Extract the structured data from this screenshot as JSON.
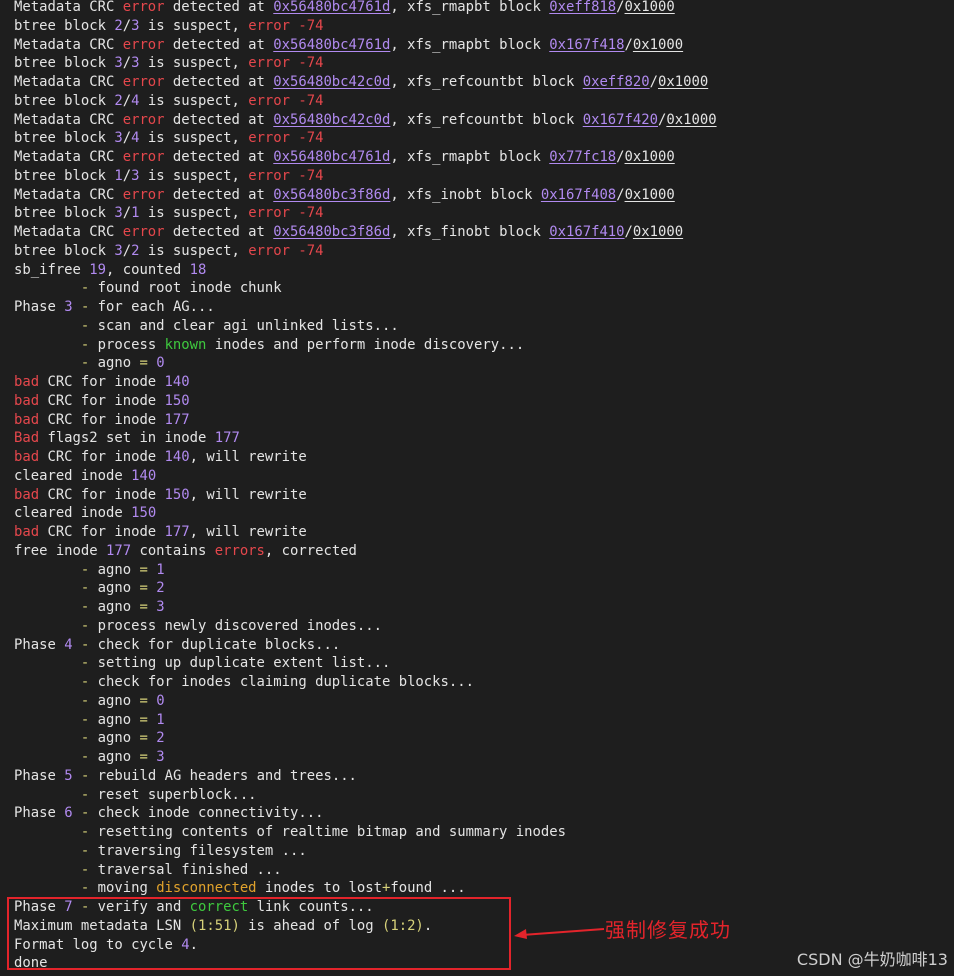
{
  "terminal_lines": [
    [
      [
        "Metadata CRC ",
        "plain"
      ],
      [
        "error",
        "red"
      ],
      [
        " detected at ",
        "plain"
      ],
      [
        "0x56480bc4761d",
        "link"
      ],
      [
        ", xfs_rmapbt block ",
        "plain"
      ],
      [
        "0xeff818",
        "link"
      ],
      [
        "/",
        "plain"
      ],
      [
        "0x1000",
        "ulw"
      ]
    ],
    [
      [
        "btree block ",
        "plain"
      ],
      [
        "2",
        "num"
      ],
      [
        "/",
        "plain"
      ],
      [
        "3",
        "num"
      ],
      [
        " is suspect, ",
        "plain"
      ],
      [
        "error",
        "red"
      ],
      [
        " ",
        "plain"
      ],
      [
        "-74",
        "red"
      ]
    ],
    [
      [
        "Metadata CRC ",
        "plain"
      ],
      [
        "error",
        "red"
      ],
      [
        " detected at ",
        "plain"
      ],
      [
        "0x56480bc4761d",
        "link"
      ],
      [
        ", xfs_rmapbt block ",
        "plain"
      ],
      [
        "0x167f418",
        "link"
      ],
      [
        "/",
        "plain"
      ],
      [
        "0x1000",
        "ulw"
      ]
    ],
    [
      [
        "btree block ",
        "plain"
      ],
      [
        "3",
        "num"
      ],
      [
        "/",
        "plain"
      ],
      [
        "3",
        "num"
      ],
      [
        " is suspect, ",
        "plain"
      ],
      [
        "error",
        "red"
      ],
      [
        " ",
        "plain"
      ],
      [
        "-74",
        "red"
      ]
    ],
    [
      [
        "Metadata CRC ",
        "plain"
      ],
      [
        "error",
        "red"
      ],
      [
        " detected at ",
        "plain"
      ],
      [
        "0x56480bc42c0d",
        "link"
      ],
      [
        ", xfs_refcountbt block ",
        "plain"
      ],
      [
        "0xeff820",
        "link"
      ],
      [
        "/",
        "plain"
      ],
      [
        "0x1000",
        "ulw"
      ]
    ],
    [
      [
        "btree block ",
        "plain"
      ],
      [
        "2",
        "num"
      ],
      [
        "/",
        "plain"
      ],
      [
        "4",
        "num"
      ],
      [
        " is suspect, ",
        "plain"
      ],
      [
        "error",
        "red"
      ],
      [
        " ",
        "plain"
      ],
      [
        "-74",
        "red"
      ]
    ],
    [
      [
        "Metadata CRC ",
        "plain"
      ],
      [
        "error",
        "red"
      ],
      [
        " detected at ",
        "plain"
      ],
      [
        "0x56480bc42c0d",
        "link"
      ],
      [
        ", xfs_refcountbt block ",
        "plain"
      ],
      [
        "0x167f420",
        "link"
      ],
      [
        "/",
        "plain"
      ],
      [
        "0x1000",
        "ulw"
      ]
    ],
    [
      [
        "btree block ",
        "plain"
      ],
      [
        "3",
        "num"
      ],
      [
        "/",
        "plain"
      ],
      [
        "4",
        "num"
      ],
      [
        " is suspect, ",
        "plain"
      ],
      [
        "error",
        "red"
      ],
      [
        " ",
        "plain"
      ],
      [
        "-74",
        "red"
      ]
    ],
    [
      [
        "Metadata CRC ",
        "plain"
      ],
      [
        "error",
        "red"
      ],
      [
        " detected at ",
        "plain"
      ],
      [
        "0x56480bc4761d",
        "link"
      ],
      [
        ", xfs_rmapbt block ",
        "plain"
      ],
      [
        "0x77fc18",
        "link"
      ],
      [
        "/",
        "plain"
      ],
      [
        "0x1000",
        "ulw"
      ]
    ],
    [
      [
        "btree block ",
        "plain"
      ],
      [
        "1",
        "num"
      ],
      [
        "/",
        "plain"
      ],
      [
        "3",
        "num"
      ],
      [
        " is suspect, ",
        "plain"
      ],
      [
        "error",
        "red"
      ],
      [
        " ",
        "plain"
      ],
      [
        "-74",
        "red"
      ]
    ],
    [
      [
        "Metadata CRC ",
        "plain"
      ],
      [
        "error",
        "red"
      ],
      [
        " detected at ",
        "plain"
      ],
      [
        "0x56480bc3f86d",
        "link"
      ],
      [
        ", xfs_inobt block ",
        "plain"
      ],
      [
        "0x167f408",
        "link"
      ],
      [
        "/",
        "plain"
      ],
      [
        "0x1000",
        "ulw"
      ]
    ],
    [
      [
        "btree block ",
        "plain"
      ],
      [
        "3",
        "num"
      ],
      [
        "/",
        "plain"
      ],
      [
        "1",
        "num"
      ],
      [
        " is suspect, ",
        "plain"
      ],
      [
        "error",
        "red"
      ],
      [
        " ",
        "plain"
      ],
      [
        "-74",
        "red"
      ]
    ],
    [
      [
        "Metadata CRC ",
        "plain"
      ],
      [
        "error",
        "red"
      ],
      [
        " detected at ",
        "plain"
      ],
      [
        "0x56480bc3f86d",
        "link"
      ],
      [
        ", xfs_finobt block ",
        "plain"
      ],
      [
        "0x167f410",
        "link"
      ],
      [
        "/",
        "plain"
      ],
      [
        "0x1000",
        "ulw"
      ]
    ],
    [
      [
        "btree block ",
        "plain"
      ],
      [
        "3",
        "num"
      ],
      [
        "/",
        "plain"
      ],
      [
        "2",
        "num"
      ],
      [
        " is suspect, ",
        "plain"
      ],
      [
        "error",
        "red"
      ],
      [
        " ",
        "plain"
      ],
      [
        "-74",
        "red"
      ]
    ],
    [
      [
        "sb_ifree ",
        "plain"
      ],
      [
        "19",
        "num"
      ],
      [
        ", counted ",
        "plain"
      ],
      [
        "18",
        "num"
      ]
    ],
    [
      [
        "        ",
        "plain"
      ],
      [
        "-",
        "gold"
      ],
      [
        " found root inode chunk",
        "plain"
      ]
    ],
    [
      [
        "Phase ",
        "plain"
      ],
      [
        "3",
        "num"
      ],
      [
        " ",
        "plain"
      ],
      [
        "-",
        "gold"
      ],
      [
        " for each AG...",
        "plain"
      ]
    ],
    [
      [
        "        ",
        "plain"
      ],
      [
        "-",
        "gold"
      ],
      [
        " scan and clear agi unlinked lists...",
        "plain"
      ]
    ],
    [
      [
        "        ",
        "plain"
      ],
      [
        "-",
        "gold"
      ],
      [
        " process ",
        "plain"
      ],
      [
        "known",
        "green"
      ],
      [
        " inodes and perform inode discovery...",
        "plain"
      ]
    ],
    [
      [
        "        ",
        "plain"
      ],
      [
        "-",
        "gold"
      ],
      [
        " agno ",
        "plain"
      ],
      [
        "=",
        "gold"
      ],
      [
        " ",
        "plain"
      ],
      [
        "0",
        "num"
      ]
    ],
    [
      [
        "bad",
        "red"
      ],
      [
        " CRC for inode ",
        "plain"
      ],
      [
        "140",
        "num"
      ]
    ],
    [
      [
        "bad",
        "red"
      ],
      [
        " CRC for inode ",
        "plain"
      ],
      [
        "150",
        "num"
      ]
    ],
    [
      [
        "bad",
        "red"
      ],
      [
        " CRC for inode ",
        "plain"
      ],
      [
        "177",
        "num"
      ]
    ],
    [
      [
        "Bad",
        "red"
      ],
      [
        " flags2 set in inode ",
        "plain"
      ],
      [
        "177",
        "num"
      ]
    ],
    [
      [
        "bad",
        "red"
      ],
      [
        " CRC for inode ",
        "plain"
      ],
      [
        "140",
        "num"
      ],
      [
        ", will rewrite",
        "plain"
      ]
    ],
    [
      [
        "cleared inode ",
        "plain"
      ],
      [
        "140",
        "num"
      ]
    ],
    [
      [
        "bad",
        "red"
      ],
      [
        " CRC for inode ",
        "plain"
      ],
      [
        "150",
        "num"
      ],
      [
        ", will rewrite",
        "plain"
      ]
    ],
    [
      [
        "cleared inode ",
        "plain"
      ],
      [
        "150",
        "num"
      ]
    ],
    [
      [
        "bad",
        "red"
      ],
      [
        " CRC for inode ",
        "plain"
      ],
      [
        "177",
        "num"
      ],
      [
        ", will rewrite",
        "plain"
      ]
    ],
    [
      [
        "free inode ",
        "plain"
      ],
      [
        "177",
        "num"
      ],
      [
        " contains ",
        "plain"
      ],
      [
        "errors",
        "red"
      ],
      [
        ", corrected",
        "plain"
      ]
    ],
    [
      [
        "        ",
        "plain"
      ],
      [
        "-",
        "gold"
      ],
      [
        " agno ",
        "plain"
      ],
      [
        "=",
        "gold"
      ],
      [
        " ",
        "plain"
      ],
      [
        "1",
        "num"
      ]
    ],
    [
      [
        "        ",
        "plain"
      ],
      [
        "-",
        "gold"
      ],
      [
        " agno ",
        "plain"
      ],
      [
        "=",
        "gold"
      ],
      [
        " ",
        "plain"
      ],
      [
        "2",
        "num"
      ]
    ],
    [
      [
        "        ",
        "plain"
      ],
      [
        "-",
        "gold"
      ],
      [
        " agno ",
        "plain"
      ],
      [
        "=",
        "gold"
      ],
      [
        " ",
        "plain"
      ],
      [
        "3",
        "num"
      ]
    ],
    [
      [
        "        ",
        "plain"
      ],
      [
        "-",
        "gold"
      ],
      [
        " process newly discovered inodes...",
        "plain"
      ]
    ],
    [
      [
        "Phase ",
        "plain"
      ],
      [
        "4",
        "num"
      ],
      [
        " ",
        "plain"
      ],
      [
        "-",
        "gold"
      ],
      [
        " check for duplicate blocks...",
        "plain"
      ]
    ],
    [
      [
        "        ",
        "plain"
      ],
      [
        "-",
        "gold"
      ],
      [
        " setting up duplicate extent list...",
        "plain"
      ]
    ],
    [
      [
        "        ",
        "plain"
      ],
      [
        "-",
        "gold"
      ],
      [
        " check for inodes claiming duplicate blocks...",
        "plain"
      ]
    ],
    [
      [
        "        ",
        "plain"
      ],
      [
        "-",
        "gold"
      ],
      [
        " agno ",
        "plain"
      ],
      [
        "=",
        "gold"
      ],
      [
        " ",
        "plain"
      ],
      [
        "0",
        "num"
      ]
    ],
    [
      [
        "        ",
        "plain"
      ],
      [
        "-",
        "gold"
      ],
      [
        " agno ",
        "plain"
      ],
      [
        "=",
        "gold"
      ],
      [
        " ",
        "plain"
      ],
      [
        "1",
        "num"
      ]
    ],
    [
      [
        "        ",
        "plain"
      ],
      [
        "-",
        "gold"
      ],
      [
        " agno ",
        "plain"
      ],
      [
        "=",
        "gold"
      ],
      [
        " ",
        "plain"
      ],
      [
        "2",
        "num"
      ]
    ],
    [
      [
        "        ",
        "plain"
      ],
      [
        "-",
        "gold"
      ],
      [
        " agno ",
        "plain"
      ],
      [
        "=",
        "gold"
      ],
      [
        " ",
        "plain"
      ],
      [
        "3",
        "num"
      ]
    ],
    [
      [
        "Phase ",
        "plain"
      ],
      [
        "5",
        "num"
      ],
      [
        " ",
        "plain"
      ],
      [
        "-",
        "gold"
      ],
      [
        " rebuild AG headers and trees...",
        "plain"
      ]
    ],
    [
      [
        "        ",
        "plain"
      ],
      [
        "-",
        "gold"
      ],
      [
        " reset superblock...",
        "plain"
      ]
    ],
    [
      [
        "Phase ",
        "plain"
      ],
      [
        "6",
        "num"
      ],
      [
        " ",
        "plain"
      ],
      [
        "-",
        "gold"
      ],
      [
        " check inode connectivity...",
        "plain"
      ]
    ],
    [
      [
        "        ",
        "plain"
      ],
      [
        "-",
        "gold"
      ],
      [
        " resetting contents of realtime bitmap and summary inodes",
        "plain"
      ]
    ],
    [
      [
        "        ",
        "plain"
      ],
      [
        "-",
        "gold"
      ],
      [
        " traversing filesystem ...",
        "plain"
      ]
    ],
    [
      [
        "        ",
        "plain"
      ],
      [
        "-",
        "gold"
      ],
      [
        " traversal finished ...",
        "plain"
      ]
    ],
    [
      [
        "        ",
        "plain"
      ],
      [
        "-",
        "gold"
      ],
      [
        " moving ",
        "plain"
      ],
      [
        "disconnected",
        "orange"
      ],
      [
        " inodes to lost",
        "plain"
      ],
      [
        "+",
        "gold"
      ],
      [
        "found ...",
        "plain"
      ]
    ],
    [
      [
        "Phase ",
        "plain"
      ],
      [
        "7",
        "num"
      ],
      [
        " ",
        "plain"
      ],
      [
        "-",
        "gold"
      ],
      [
        " verify and ",
        "plain"
      ],
      [
        "correct",
        "green"
      ],
      [
        " link counts...",
        "plain"
      ]
    ],
    [
      [
        "Maximum metadata LSN ",
        "plain"
      ],
      [
        "(1:51)",
        "gold"
      ],
      [
        " is ahead of log ",
        "plain"
      ],
      [
        "(1:2)",
        "gold"
      ],
      [
        ".",
        "plain"
      ]
    ],
    [
      [
        "Format log to cycle ",
        "plain"
      ],
      [
        "4",
        "num"
      ],
      [
        ".",
        "plain"
      ]
    ],
    [
      [
        "done",
        "plain"
      ]
    ]
  ],
  "annotation": {
    "text": "强制修复成功",
    "color": "#e3242b"
  },
  "watermark": "CSDN @牛奶咖啡13",
  "colors": {
    "background": "#1e1e1e",
    "text": "#e4e4e4",
    "error_red": "#e5474c",
    "number_purple": "#b18af0",
    "keyword_green": "#3ec93e",
    "keyword_orange": "#e0a22c",
    "operator_gold": "#d7d27a"
  }
}
